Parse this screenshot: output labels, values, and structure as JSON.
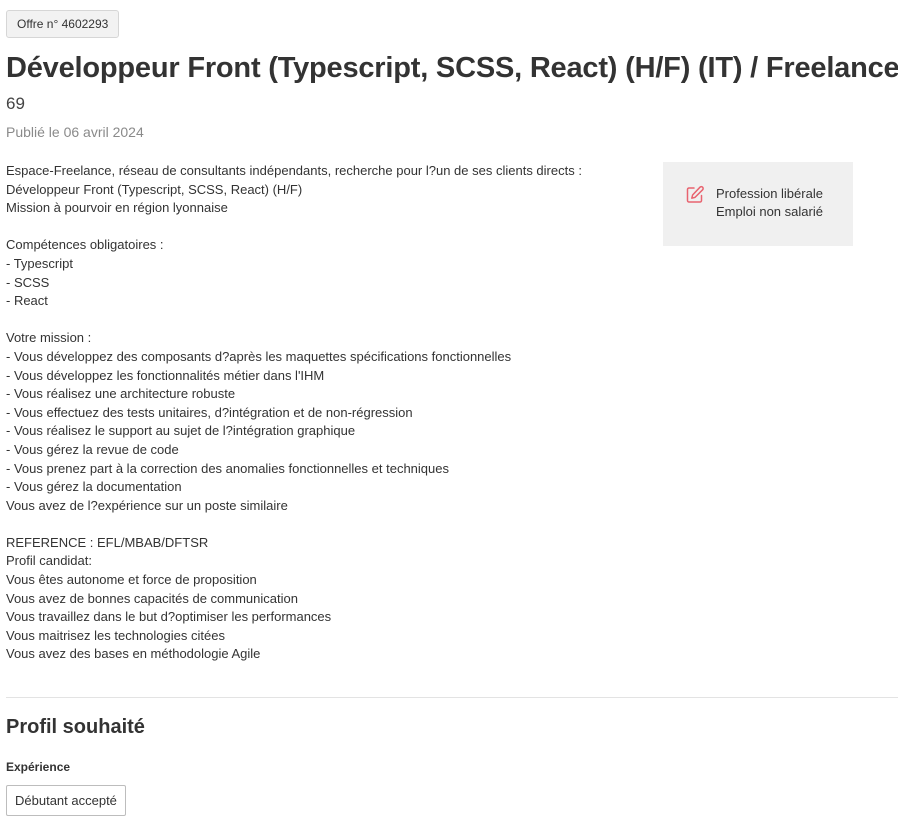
{
  "offer_badge": "Offre n° 4602293",
  "title": "Développeur Front (Typescript, SCSS, React) (H/F) (IT) / Freelance",
  "location": "69",
  "published": "Publié le 06 avril 2024",
  "description_lines": [
    "Espace-Freelance, réseau de consultants indépendants, recherche pour l?un de ses clients directs :",
    "Développeur Front (Typescript, SCSS, React) (H/F)",
    "Mission à pourvoir en région lyonnaise",
    "",
    "Compétences obligatoires :",
    "- Typescript",
    "- SCSS",
    "- React",
    "",
    "Votre mission :",
    "- Vous développez des composants d?après les maquettes spécifications fonctionnelles",
    "- Vous développez les fonctionnalités métier dans l'IHM",
    "- Vous réalisez une architecture robuste",
    "- Vous effectuez des tests unitaires, d?intégration et de non-régression",
    "- Vous réalisez le support au sujet de l?intégration graphique",
    "- Vous gérez la revue de code",
    "- Vous prenez part à la correction des anomalies fonctionnelles et techniques",
    "- Vous gérez la documentation",
    "Vous avez de l?expérience sur un poste similaire",
    "",
    "REFERENCE : EFL/MBAB/DFTSR",
    "Profil candidat:",
    "Vous êtes autonome et force de proposition",
    "Vous avez de bonnes capacités de communication",
    "Vous travaillez dans le but d?optimiser les performances",
    "Vous maitrisez les technologies citées",
    "Vous avez des bases en méthodologie Agile"
  ],
  "side_box": {
    "icon": "edit-icon",
    "line1": "Profession libérale",
    "line2": "Emploi non salarié",
    "icon_color": "#e8636f"
  },
  "profile_section": {
    "title": "Profil souhaité",
    "experience_label": "Expérience",
    "experience_value": "Débutant accepté"
  }
}
